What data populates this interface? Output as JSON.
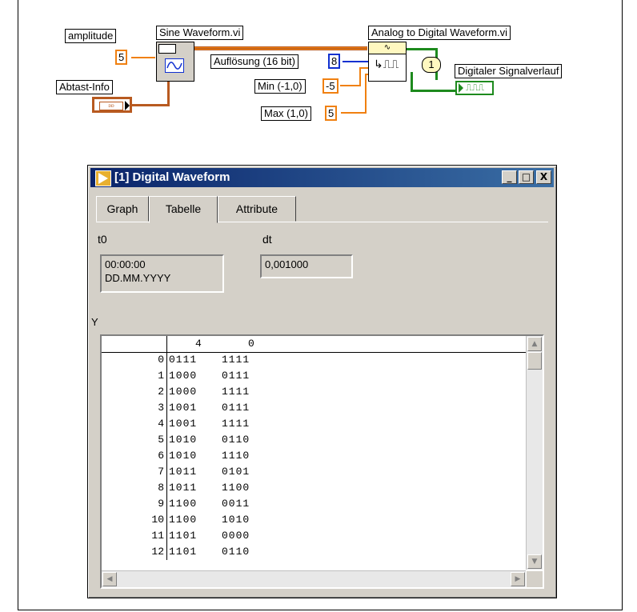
{
  "diagram": {
    "amplitude_label": "amplitude",
    "amplitude_value": "5",
    "abtast_label": "Abtast-Info",
    "sine_vi_label": "Sine Waveform.vi",
    "a2d_vi_label": "Analog to Digital Waveform.vi",
    "aufloesung_label": "Auflösung (16 bit)",
    "aufloesung_value": "8",
    "min_label": "Min (-1,0)",
    "min_value": "-5",
    "max_label": "Max (1,0)",
    "max_value": "5",
    "index_value": "1",
    "digital_label": "Digitaler Signalverlauf"
  },
  "window": {
    "title": "[1] Digital Waveform",
    "minimize": "_",
    "maximize": "□",
    "close": "X",
    "tabs": [
      "Graph",
      "Tabelle",
      "Attribute"
    ],
    "active_tab": "Tabelle",
    "t0_label": "t0",
    "t0_value_line1": "00:00:00",
    "t0_value_line2": "DD.MM.YYYY",
    "dt_label": "dt",
    "dt_value": "0,001000",
    "y_label": "Y",
    "table": {
      "header_col1": "4",
      "header_col2": "0",
      "rows": [
        {
          "index": "0",
          "high": "0111",
          "low": "1111"
        },
        {
          "index": "1",
          "high": "1000",
          "low": "0111"
        },
        {
          "index": "2",
          "high": "1000",
          "low": "1111"
        },
        {
          "index": "3",
          "high": "1001",
          "low": "0111"
        },
        {
          "index": "4",
          "high": "1001",
          "low": "1111"
        },
        {
          "index": "5",
          "high": "1010",
          "low": "0110"
        },
        {
          "index": "6",
          "high": "1010",
          "low": "1110"
        },
        {
          "index": "7",
          "high": "1011",
          "low": "0101"
        },
        {
          "index": "8",
          "high": "1011",
          "low": "1100"
        },
        {
          "index": "9",
          "high": "1100",
          "low": "0011"
        },
        {
          "index": "10",
          "high": "1100",
          "low": "1010"
        },
        {
          "index": "11",
          "high": "1101",
          "low": "0000"
        },
        {
          "index": "12",
          "high": "1101",
          "low": "0110"
        }
      ]
    }
  }
}
